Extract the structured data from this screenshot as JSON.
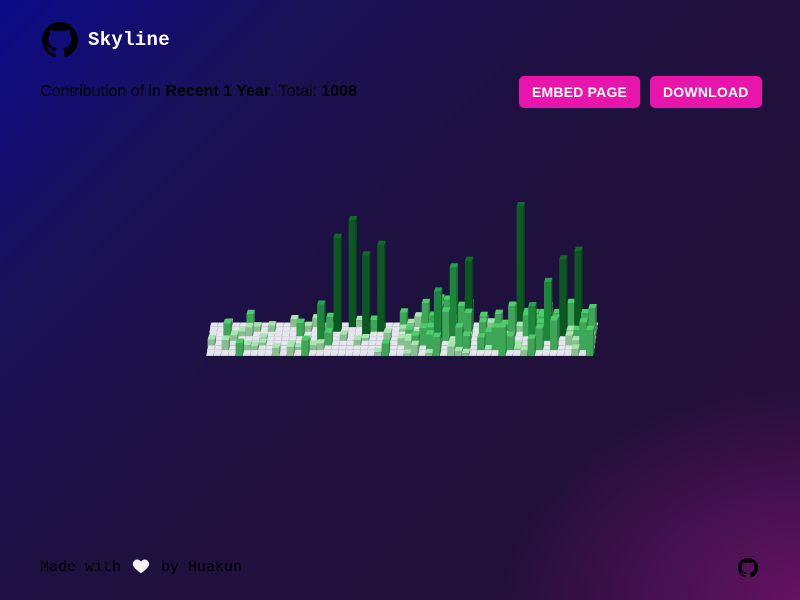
{
  "app": {
    "title": "Skyline",
    "logo_icon": "github-icon"
  },
  "summary": {
    "prefix": "Contribution of in ",
    "period": "Recent 1 Year",
    "total_label": ". Total: ",
    "total_value": "1008"
  },
  "actions": {
    "embed_label": "EMBED PAGE",
    "download_label": "DOWNLOAD",
    "color": "#e815ad"
  },
  "footer": {
    "made_with": "Made with",
    "heart_icon": "heart-icon",
    "by": "by Huakun",
    "github_icon": "github-icon"
  },
  "skyline": {
    "weeks": 53,
    "days": 7,
    "empty_color": "#e6e6ee",
    "level_colors": [
      "#a8e6b0",
      "#4ccc6a",
      "#22a548",
      "#0f6b2a"
    ]
  }
}
